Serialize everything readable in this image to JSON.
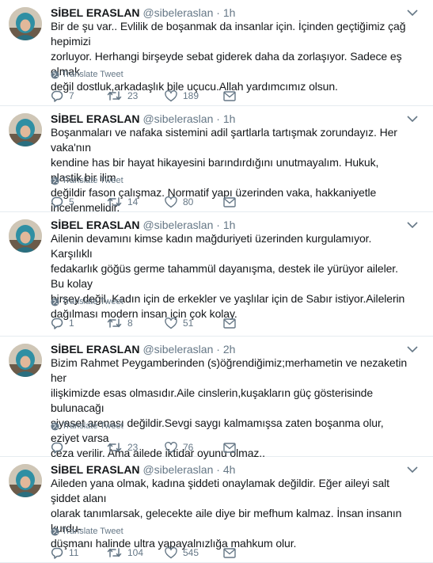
{
  "tweets": [
    {
      "name": "SİBEL ERASLAN",
      "handle": "@sibeleraslan",
      "separator": "·",
      "time": "1h",
      "lines": [
        "Bir de şu var.. Evlilik de boşanmak da insanlar için. İçinden geçtiğimiz çağ hepimizi",
        "zorluyor. Herhangi birşeyde sebat giderek daha da zorlaşıyor. Sadece eş olmak",
        "değil dostluk,arkadaşlık bile uçucu.Allah yardımcımız olsun."
      ],
      "translate": "Translate Tweet",
      "replies": "7",
      "retweets": "23",
      "likes": "189"
    },
    {
      "name": "SİBEL ERASLAN",
      "handle": "@sibeleraslan",
      "separator": "·",
      "time": "1h",
      "lines": [
        "Boşanmaları ve nafaka sistemini adil şartlarla tartışmak zorundayız. Her vaka'nın",
        "kendine has bir hayat hikayesini barındırdığını unutmayalım. Hukuk, plastik bir ilim",
        "değildir fason çalışmaz. Normatif yapı üzerinden vaka, hakkaniyetle incelenmelidir."
      ],
      "translate": "Translate Tweet",
      "replies": "5",
      "retweets": "14",
      "likes": "80"
    },
    {
      "name": "SİBEL ERASLAN",
      "handle": "@sibeleraslan",
      "separator": "·",
      "time": "1h",
      "lines": [
        "Ailenin devamını kimse kadın mağduriyeti üzerinden kurgulamıyor. Karşılıklı",
        "fedakarlık göğüs germe tahammül dayanışma, destek ile yürüyor aileler. Bu kolay",
        "birşey değil. Kadın için de erkekler ve yaşlılar için de Sabır istiyor.Ailelerin",
        "dağılması modern insan için çok kolay."
      ],
      "translate": "Translate Tweet",
      "replies": "1",
      "retweets": "8",
      "likes": "51"
    },
    {
      "name": "SİBEL ERASLAN",
      "handle": "@sibeleraslan",
      "separator": "·",
      "time": "2h",
      "lines": [
        "Bizim Rahmet Peygamberinden (s)öğrendiğimiz;merhametin ve nezaketin her",
        "ilişkimizde esas olmasıdır.Aile cinslerin,kuşakların güç gösterisinde bulunacağı",
        "siyaset arenası değildir.Sevgi saygı kalmamışsa zaten boşanma olur, eziyet varsa",
        "ceza verilir. Ama ailede iktidar oyunu olmaz.."
      ],
      "translate": "Translate Tweet",
      "replies": "",
      "retweets": "23",
      "likes": "76"
    },
    {
      "name": "SİBEL ERASLAN",
      "handle": "@sibeleraslan",
      "separator": "·",
      "time": "4h",
      "lines": [
        "Aileden yana olmak, kadına şiddeti onaylamak değildir. Eğer aileyi salt şiddet alanı",
        "olarak tanımlarsak, gelecekte aile diye bir mefhum kalmaz. İnsan insanın kurdu-",
        "düşmanı halinde ultra yapayalnızlığa mahkum olur."
      ],
      "translate": "Translate Tweet",
      "replies": "11",
      "retweets": "104",
      "likes": "545"
    }
  ],
  "icons": {
    "caret": "chevron-down-icon",
    "globe": "globe-icon",
    "reply": "reply-icon",
    "retweet": "retweet-icon",
    "like": "heart-icon",
    "dm": "envelope-icon"
  },
  "colors": {
    "text": "#14171a",
    "secondary": "#657786",
    "divider": "#e6ecf0"
  }
}
